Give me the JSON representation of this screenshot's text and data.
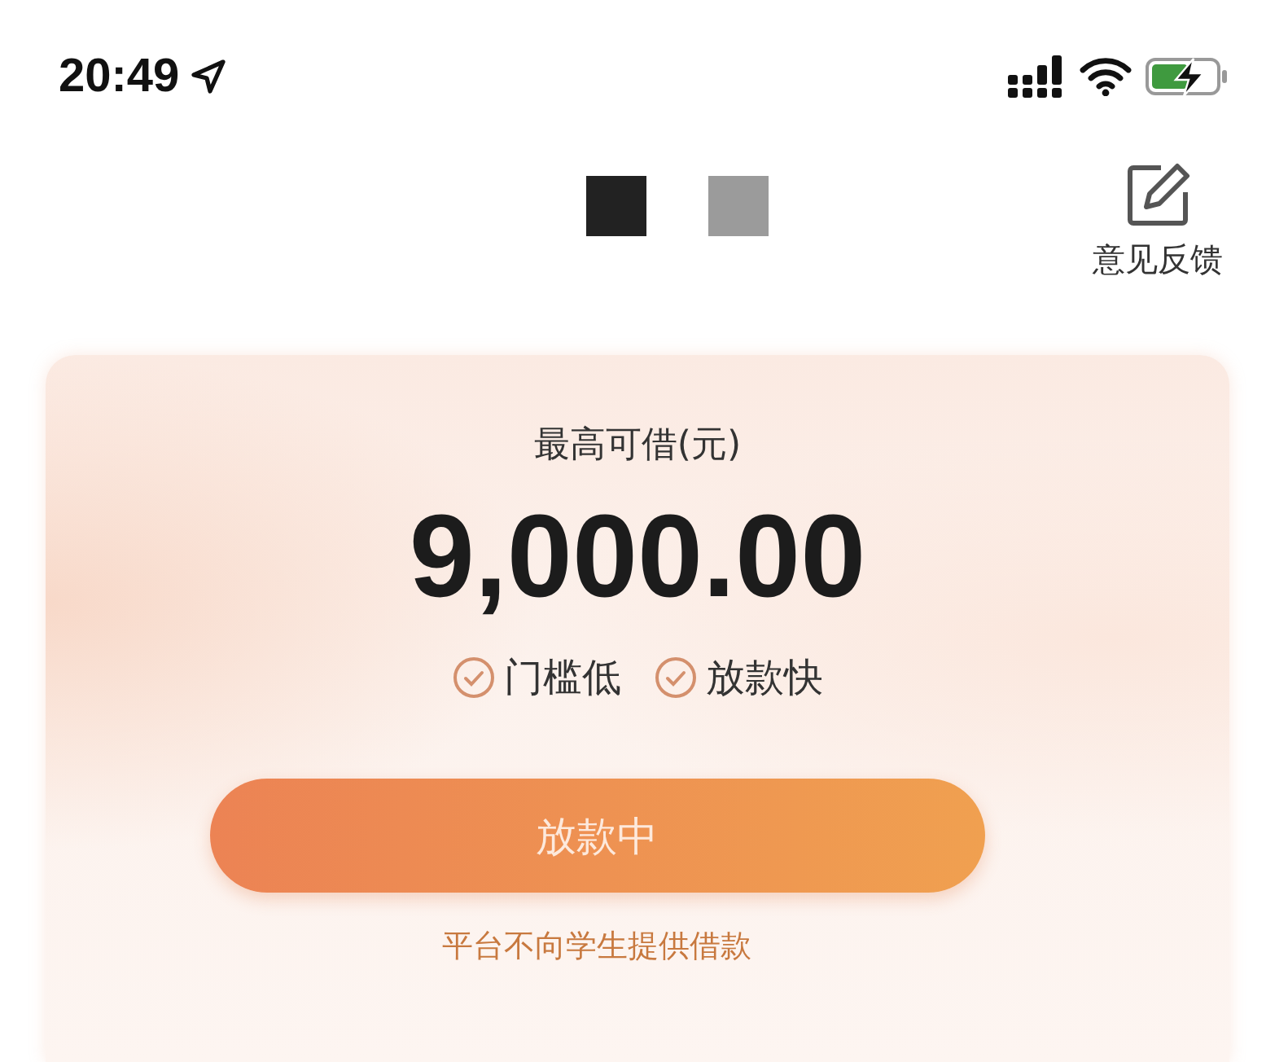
{
  "status_bar": {
    "time": "20:49"
  },
  "header": {
    "feedback_label": "意见反馈"
  },
  "loan_card": {
    "label": "最高可借(元)",
    "amount": "9,000.00",
    "features": [
      {
        "label": "门槛低"
      },
      {
        "label": "放款快"
      }
    ],
    "button": {
      "label": "放款中",
      "disabled": true
    },
    "note": "平台不向学生提供借款"
  }
}
